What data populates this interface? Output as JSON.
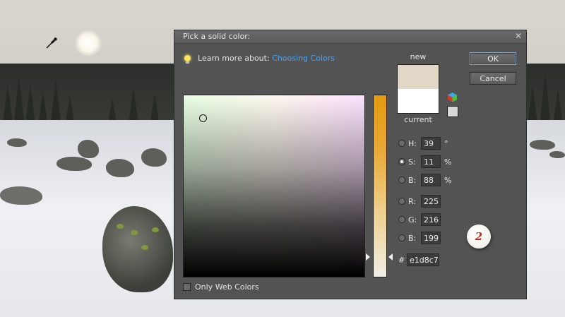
{
  "dialog": {
    "title": "Pick a solid color:",
    "close_icon": "close-icon",
    "hint_prefix": "Learn more about:",
    "hint_link": "Choosing Colors",
    "label_new": "new",
    "label_current": "current",
    "ok_label": "OK",
    "cancel_label": "Cancel",
    "only_web_colors_label": "Only Web Colors",
    "only_web_colors_checked": false
  },
  "colors": {
    "new_color": "#e1d8c7",
    "current_color": "#ffffff",
    "picker_hue": "#e49a10"
  },
  "fields": {
    "h": {
      "label": "H:",
      "value": "39",
      "unit": "°",
      "selected": false
    },
    "s": {
      "label": "S:",
      "value": "11",
      "unit": "%",
      "selected": true
    },
    "b": {
      "label": "B:",
      "value": "88",
      "unit": "%",
      "selected": false
    },
    "r": {
      "label": "R:",
      "value": "225",
      "selected": false
    },
    "g": {
      "label": "G:",
      "value": "216",
      "selected": false
    },
    "b2": {
      "label": "B:",
      "value": "199",
      "selected": false
    },
    "hex_symbol": "#",
    "hex": "e1d8c7"
  },
  "annotation": {
    "step_number": "2"
  },
  "icons": {
    "bulb": "lightbulb-icon",
    "cube": "color-cube-icon",
    "eyedropper": "eyedropper-icon"
  }
}
